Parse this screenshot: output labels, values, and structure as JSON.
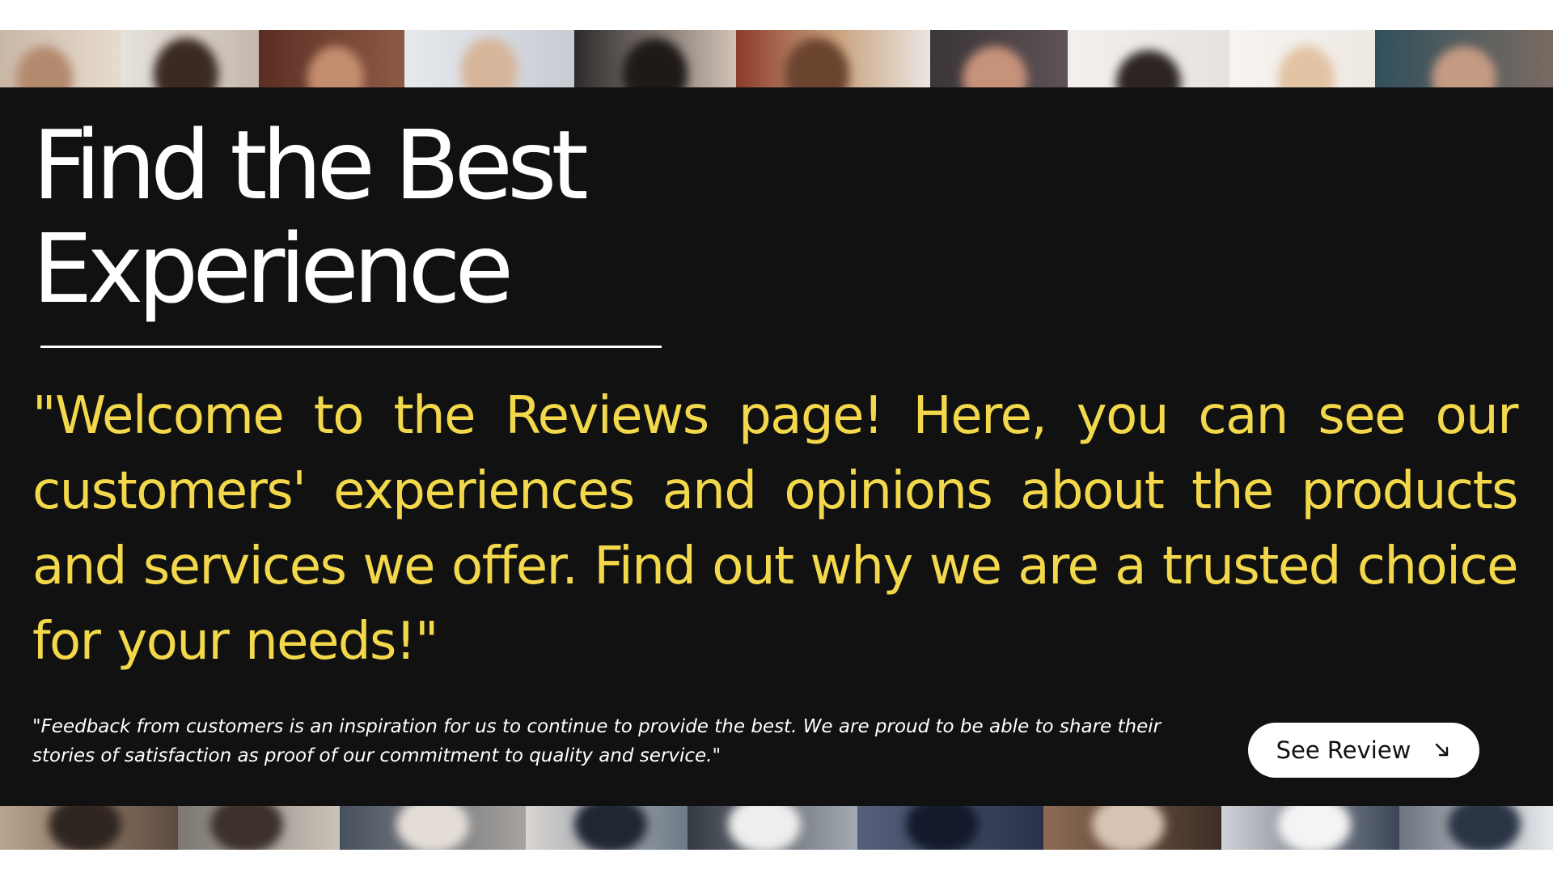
{
  "hero": {
    "title_line1": "Find the Best",
    "title_line2": "Experience",
    "welcome_text": "\"Welcome to the Reviews page! Here, you can see our customers' experiences and opinions about the products and services we offer. Find out why we are a trusted choice for your needs!\"",
    "feedback_text": "\"Feedback from customers is an inspiration for us to continue to provide the best. We are proud to be able to share their stories of satisfaction as proof of our commitment to quality and service.\"",
    "button_label": "See Review",
    "button_icon": "arrow-down-right-icon"
  },
  "colors": {
    "panel_background": "#111111",
    "accent_yellow": "#f2d84a",
    "text_white": "#ffffff"
  }
}
